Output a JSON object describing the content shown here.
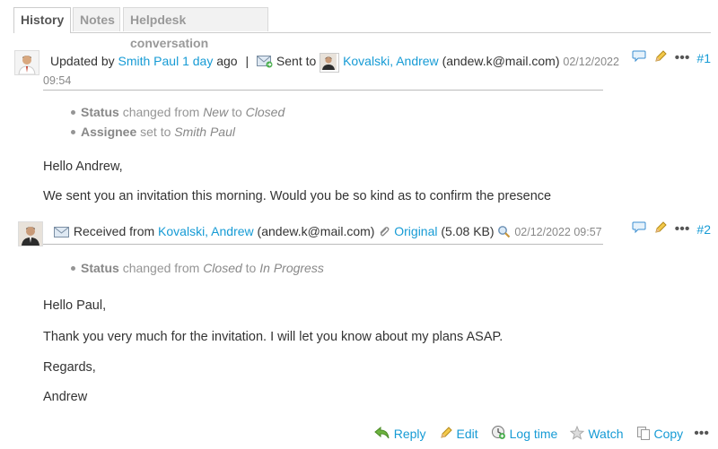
{
  "tabs": [
    {
      "label": "History",
      "active": true
    },
    {
      "label": "Notes",
      "active": false
    },
    {
      "label": "Helpdesk conversation",
      "active": false
    }
  ],
  "journal1": {
    "prefix": "Updated by",
    "author": "Smith Paul",
    "age": "1 day",
    "age_suffix": "ago",
    "separator": "|",
    "sent_to": "Sent to",
    "recipient": "Kovalski, Andrew",
    "email": "(andew.k@mail.com)",
    "date": "02/12/2022",
    "time": "09:54",
    "number": "#1",
    "details": [
      {
        "field": "Status",
        "action": "changed from",
        "from": "New",
        "to_word": "to",
        "to": "Closed"
      },
      {
        "field": "Assignee",
        "action": "set to",
        "to": "Smith Paul"
      }
    ],
    "notes": [
      "Hello Andrew,",
      "We sent you an invitation this morning. Would you be so kind as to confirm the presence"
    ]
  },
  "journal2": {
    "received_from": "Received from",
    "sender": "Kovalski, Andrew",
    "email": "(andew.k@mail.com)",
    "attachment": "Original",
    "attachment_size": "(5.08 KB)",
    "datetime": "02/12/2022 09:57",
    "number": "#2",
    "details": [
      {
        "field": "Status",
        "action": "changed from",
        "from": "Closed",
        "to_word": "to",
        "to": "In Progress"
      }
    ],
    "notes": [
      "Hello Paul,",
      "Thank you very much for the invitation. I will let you know about my plans ASAP.",
      "Regards,",
      "Andrew"
    ]
  },
  "bottom_actions": {
    "reply": "Reply",
    "edit": "Edit",
    "log_time": "Log time",
    "watch": "Watch",
    "copy": "Copy"
  },
  "colors": {
    "link": "#169bd5",
    "muted": "#959595"
  }
}
